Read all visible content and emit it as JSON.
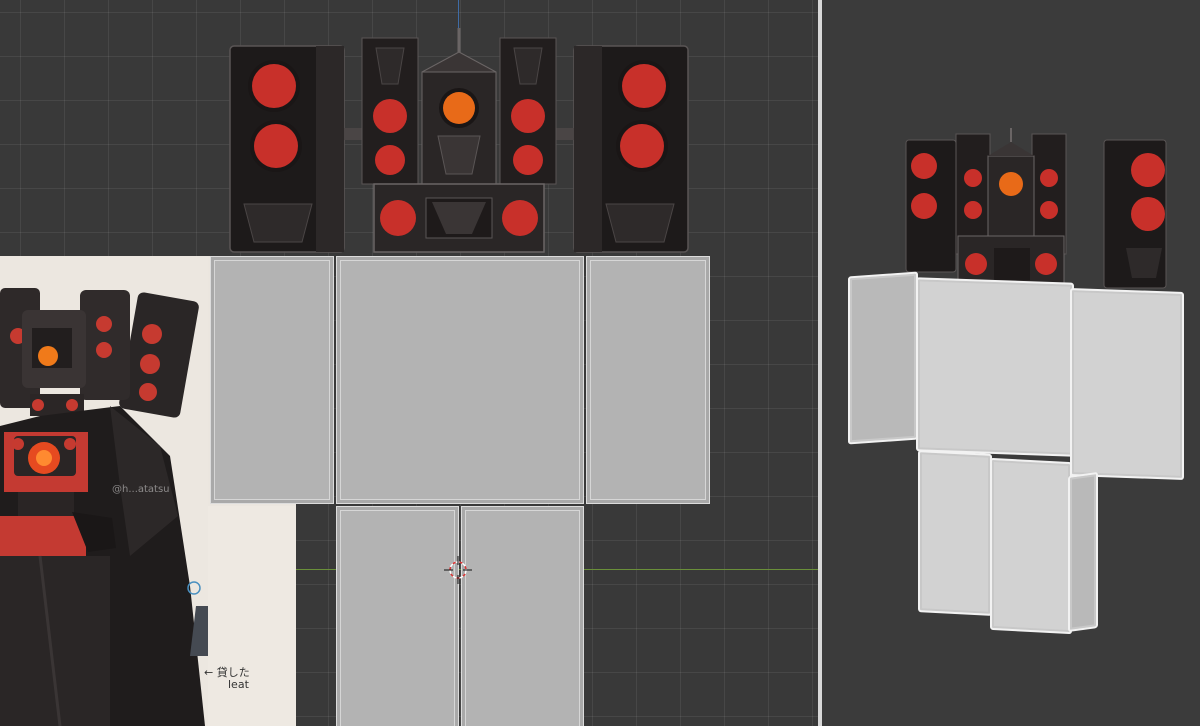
{
  "reference": {
    "watermark": "@h...atatsu",
    "note_line1": "← 貸した",
    "note_line2": "leat"
  },
  "colors": {
    "viewport_bg": "#393939",
    "grid": "#4a4a4a",
    "body_part": "#b3b3b3",
    "speaker_body": "#1c1a1a",
    "speaker_cone": "#c8302a",
    "core_glow": "#f07a1a",
    "cyan_core": "#39c8e8",
    "x_axis": "#6a8f3a",
    "z_axis": "#3f6ca6"
  },
  "icons": {
    "cursor": "3d-cursor-icon",
    "speaker_head": "speaker-head-icon",
    "character_art": "titan-speakerman-illustration"
  }
}
